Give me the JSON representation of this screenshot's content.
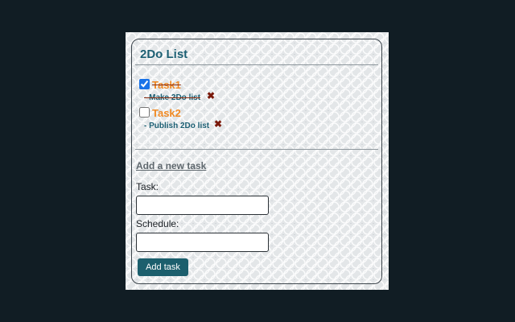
{
  "app": {
    "title": "2Do List"
  },
  "tasks": [
    {
      "name": "Task1",
      "schedule": "- Make 2Do list",
      "done": true,
      "delete_icon": "cross-icon"
    },
    {
      "name": "Task2",
      "schedule": "- Publish 2Do list",
      "done": false,
      "delete_icon": "cross-icon"
    }
  ],
  "form": {
    "heading": "Add a new task",
    "task_label": "Task:",
    "task_value": "",
    "schedule_label": "Schedule:",
    "schedule_value": "",
    "submit_label": "Add task"
  },
  "colors": {
    "page_background": "#111d24",
    "accent": "#1c5f6d",
    "task_name": "#f08a24",
    "delete": "#7b1a0c"
  }
}
